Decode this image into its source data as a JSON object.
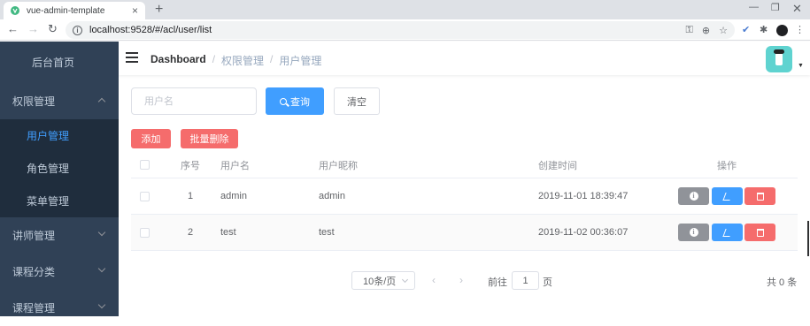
{
  "browser": {
    "tab_title": "vue-admin-template",
    "tab_close": "×",
    "new_tab": "+",
    "url": "localhost:9528/#/acl/user/list",
    "win_min": "—",
    "win_max": "❐",
    "win_close": "✕"
  },
  "sidebar": {
    "home": "后台首页",
    "groups": [
      {
        "label": "权限管理",
        "expanded": true
      },
      {
        "label": "讲师管理"
      },
      {
        "label": "课程分类"
      },
      {
        "label": "课程管理"
      }
    ],
    "submenu": [
      {
        "label": "用户管理",
        "active": true
      },
      {
        "label": "角色管理"
      },
      {
        "label": "菜单管理"
      }
    ]
  },
  "navbar": {
    "breadcrumb": [
      "Dashboard",
      "权限管理",
      "用户管理"
    ],
    "separator": "/"
  },
  "search": {
    "placeholder": "用户名",
    "search_label": "查询",
    "clear_label": "清空"
  },
  "actions": {
    "add_label": "添加",
    "batch_delete_label": "批量删除"
  },
  "table": {
    "columns": [
      "序号",
      "用户名",
      "用户昵称",
      "创建时间",
      "操作"
    ],
    "rows": [
      {
        "index": "1",
        "username": "admin",
        "nickname": "admin",
        "created": "2019-11-01 18:39:47"
      },
      {
        "index": "2",
        "username": "test",
        "nickname": "test",
        "created": "2019-11-02 00:36:07"
      }
    ]
  },
  "pagination": {
    "page_size": "10条/页",
    "prev": "‹",
    "next": "›",
    "goto_label": "前往",
    "current_page": "1",
    "page_label": "页",
    "total": "共 0 条"
  },
  "colors": {
    "sidebar_bg": "#304156",
    "submenu_bg": "#1f2d3d",
    "primary": "#409eff",
    "danger": "#f56c6c",
    "info": "#909399"
  }
}
